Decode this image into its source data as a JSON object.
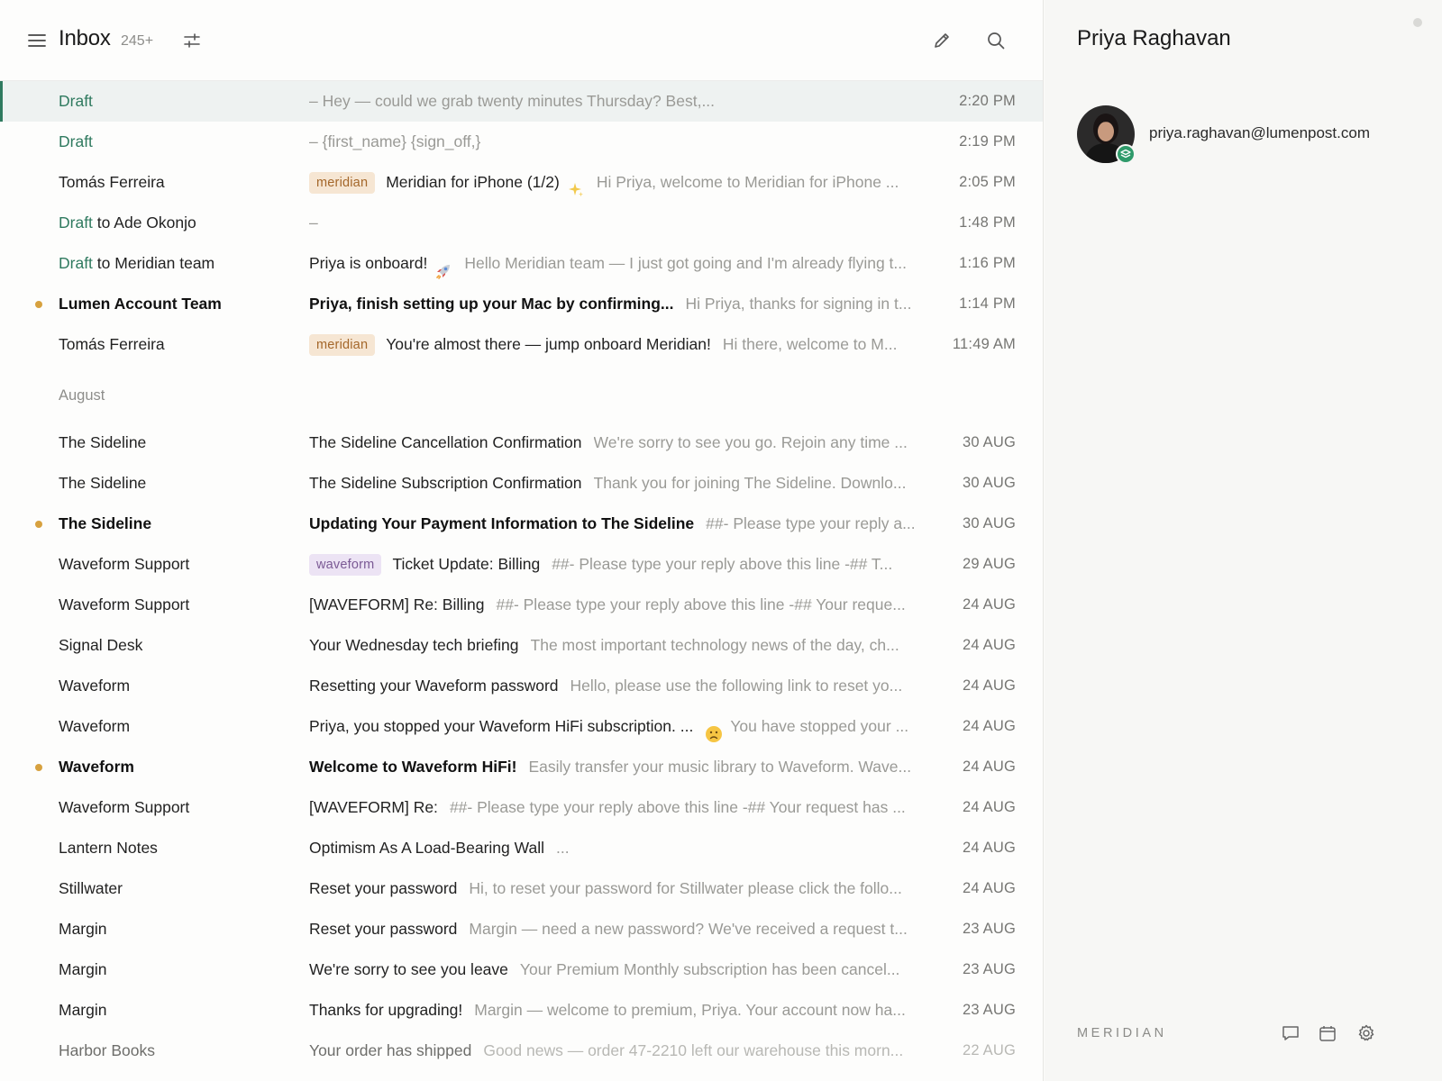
{
  "header": {
    "title": "Inbox",
    "count": "245+",
    "menu_icon": "hamburger-menu-icon",
    "filter_icon": "sliders-filter-icon",
    "compose_icon": "pencil-compose-icon",
    "search_icon": "search-icon"
  },
  "colors": {
    "accent_green": "#2f7a5f",
    "unread_dot": "#d7a13f",
    "tag_meridian_bg": "#f6e6d3",
    "tag_waveform_bg": "#ece3f4"
  },
  "today": [
    {
      "draft_label": "Draft",
      "to_text": "",
      "subject": "",
      "preview": "– Hey — could we grab twenty minutes Thursday? Best,...",
      "time": "2:20 PM",
      "selected": true
    },
    {
      "draft_label": "Draft",
      "to_text": "",
      "subject": "",
      "preview": "– {first_name} {sign_off,}",
      "time": "2:19 PM"
    },
    {
      "sender": "Tomás Ferreira",
      "tag": "meridian",
      "subject": "Meridian for iPhone (1/2)",
      "emoji": "sparkles",
      "preview": "Hi Priya, welcome to Meridian for iPhone ...",
      "time": "2:05 PM"
    },
    {
      "draft_label": "Draft",
      "to_text": " to Ade Okonjo",
      "subject": "",
      "preview": "–",
      "time": "1:48 PM"
    },
    {
      "draft_label": "Draft",
      "to_text": " to Meridian team",
      "subject": "Priya is onboard!",
      "emoji": "rocket",
      "preview": "Hello Meridian team — I just got going and I'm already flying t...",
      "time": "1:16 PM"
    },
    {
      "sender": "Lumen Account Team",
      "subject": "Priya, finish setting up your Mac by confirming...",
      "preview": "Hi Priya, thanks for signing in t...",
      "time": "1:14 PM",
      "unread": true
    },
    {
      "sender": "Tomás Ferreira",
      "tag": "meridian",
      "subject": "You're almost there — jump onboard Meridian!",
      "preview": "Hi there, welcome to M...",
      "time": "11:49 AM"
    }
  ],
  "section_label": "August",
  "august": [
    {
      "sender": "The Sideline",
      "subject": "The Sideline Cancellation Confirmation",
      "preview": "We're sorry to see you go. Rejoin any time ...",
      "time": "30 AUG"
    },
    {
      "sender": "The Sideline",
      "subject": "The Sideline Subscription Confirmation",
      "preview": "Thank you for joining The Sideline. Downlo...",
      "time": "30 AUG"
    },
    {
      "sender": "The Sideline",
      "subject": "Updating Your Payment Information to The Sideline",
      "preview": "##- Please type your reply a...",
      "time": "30 AUG",
      "unread": true
    },
    {
      "sender": "Waveform Support",
      "tag": "waveform",
      "subject": "Ticket Update: Billing",
      "preview": "##- Please type your reply above this line -## T...",
      "time": "29 AUG"
    },
    {
      "sender": "Waveform Support",
      "subject": "[WAVEFORM] Re: Billing",
      "preview": "##- Please type your reply above this line -## Your reque...",
      "time": "24 AUG"
    },
    {
      "sender": "Signal Desk",
      "subject": "Your Wednesday tech briefing",
      "preview": "The most important technology news of the day, ch...",
      "time": "24 AUG"
    },
    {
      "sender": "Waveform",
      "subject": "Resetting your Waveform password",
      "preview": "Hello, please use the following link to reset yo...",
      "time": "24 AUG"
    },
    {
      "sender": "Waveform",
      "subject": "Priya, you stopped your Waveform HiFi subscription. ...",
      "lead_emoji": "frowning-face",
      "preview": "You have stopped your ...",
      "time": "24 AUG"
    },
    {
      "sender": "Waveform",
      "subject": "Welcome to Waveform HiFi!",
      "preview": "Easily transfer your music library to Waveform. Wave...",
      "time": "24 AUG",
      "unread": true
    },
    {
      "sender": "Waveform Support",
      "subject": "[WAVEFORM] Re:",
      "preview": "##- Please type your reply above this line -## Your request has ...",
      "time": "24 AUG"
    },
    {
      "sender": "Lantern Notes",
      "subject": "Optimism As A Load-Bearing Wall",
      "preview": "...",
      "time": "24 AUG"
    },
    {
      "sender": "Stillwater",
      "subject": "Reset your password",
      "preview": "Hi, to reset your password for Stillwater please click the follo...",
      "time": "24 AUG"
    },
    {
      "sender": "Margin",
      "subject": "Reset your password",
      "preview": "Margin — need a new password? We've received a request t...",
      "time": "23 AUG"
    },
    {
      "sender": "Margin",
      "subject": "We're sorry to see you leave",
      "preview": "Your Premium Monthly subscription has been cancel...",
      "time": "23 AUG"
    },
    {
      "sender": "Margin",
      "subject": "Thanks for upgrading!",
      "preview": "Margin — welcome to premium, Priya. Your account now ha...",
      "time": "23 AUG"
    },
    {
      "sender": "Harbor Books",
      "subject": "Your order has shipped",
      "preview": "Good news — order 47-2210 left our warehouse this morn...",
      "time": "22 AUG",
      "faded": true
    }
  ],
  "contact": {
    "name": "Priya Raghavan",
    "email": "priya.raghavan@lumenpost.com",
    "avatar_icon": "avatar",
    "badge_icon": "layers-badge-icon"
  },
  "footer": {
    "brand": "MERIDIAN",
    "icons": [
      "chat-bubble-icon",
      "calendar-icon",
      "settings-gear-icon"
    ]
  }
}
